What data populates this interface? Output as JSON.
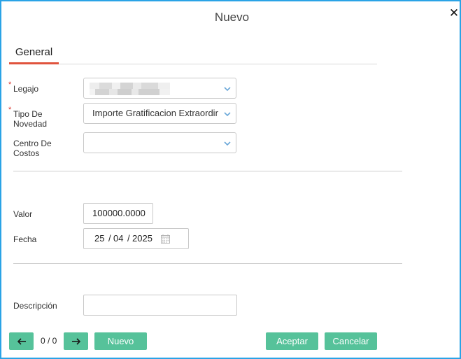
{
  "dialog": {
    "title": "Nuevo",
    "close_glyph": "✕"
  },
  "tabs": [
    {
      "label": "General",
      "active": true
    }
  ],
  "form": {
    "legajo": {
      "label": "Legajo",
      "required_mark": "*",
      "value": "",
      "icon": "chevron-down-icon"
    },
    "tipo_novedad": {
      "label_line1": "Tipo De",
      "label_line2": "Novedad",
      "required_mark": "*",
      "value": "Importe Gratificacion Extraordinaria",
      "icon": "chevron-down-icon"
    },
    "centro_costos": {
      "label_line1": "Centro De",
      "label_line2": "Costos",
      "value": "",
      "icon": "chevron-down-icon"
    },
    "valor": {
      "label": "Valor",
      "value": "100000.0000"
    },
    "fecha": {
      "label": "Fecha",
      "day": "25",
      "month": "04",
      "year": "2025",
      "separator": "/",
      "icon": "calendar-icon"
    },
    "descripcion": {
      "label": "Descripción",
      "value": ""
    }
  },
  "footer": {
    "prev_icon": "arrow-left-icon",
    "next_icon": "arrow-right-icon",
    "pager_text": "0 / 0",
    "nuevo_label": "Nuevo",
    "aceptar_label": "Aceptar",
    "cancelar_label": "Cancelar"
  },
  "colors": {
    "border": "#2aa3e6",
    "tab_underline": "#e0533d",
    "button": "#56c29a",
    "required": "#d9342b",
    "chevron": "#6aa7d8"
  }
}
